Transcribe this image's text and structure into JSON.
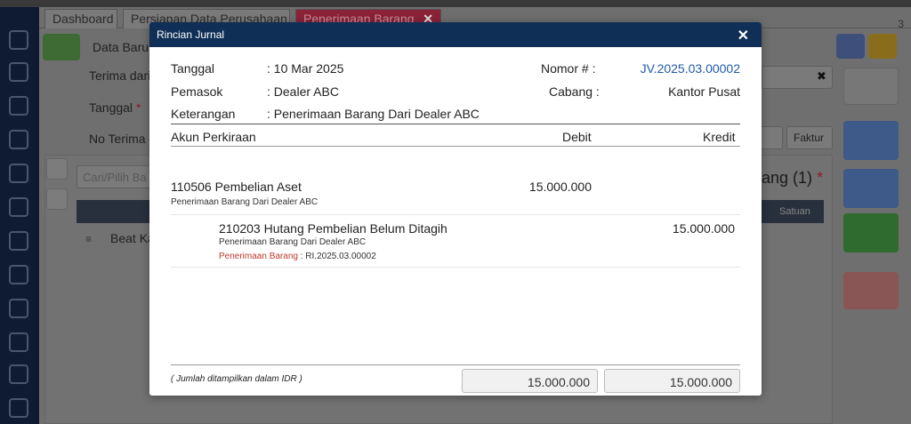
{
  "tabs": [
    {
      "label": "Dashboard"
    },
    {
      "label": "Persiapan Data Perusahaan"
    },
    {
      "label": "Penerimaan Barang"
    }
  ],
  "tab_count": "3",
  "background": {
    "data_baru_label": "Data Baru",
    "terima_dari_label": "Terima dari",
    "tanggal_label": "Tanggal",
    "required_mark": "*",
    "no_terima_label": "No Terima #",
    "search_placeholder": "Cari/Pilih Ba",
    "barang_count": "ang (1)",
    "row_item": "Beat Ka",
    "satuan_header": "Satuan",
    "faktur_button": "Faktur"
  },
  "modal": {
    "title": "Rincian Jurnal",
    "tanggal_label": "Tanggal",
    "tanggal_value": ": 10 Mar 2025",
    "pemasok_label": "Pemasok",
    "pemasok_value": ": Dealer ABC",
    "keterangan_label": "Keterangan",
    "keterangan_value": ": Penerimaan Barang Dari Dealer ABC",
    "nomor_label": "Nomor # :",
    "nomor_value": "JV.2025.03.00002",
    "cabang_label": "Cabang :",
    "cabang_value": "Kantor Pusat",
    "columns": {
      "akun": "Akun Perkiraan",
      "debit": "Debit",
      "kredit": "Kredit"
    },
    "entries": [
      {
        "account": "110506 Pembelian Aset",
        "description": "Penerimaan Barang Dari Dealer ABC",
        "debit": "15.000.000",
        "kredit": ""
      },
      {
        "account": "210203 Hutang Pembelian Belum Ditagih",
        "description": "Penerimaan Barang Dari Dealer ABC",
        "ref_label": "Penerimaan Barang",
        "ref_value": " : RI.2025.03.00002",
        "debit": "",
        "kredit": "15.000.000"
      }
    ],
    "footer_note": "( Jumlah ditampilkan dalam IDR )",
    "total_debit": "15.000.000",
    "total_kredit": "15.000.000"
  },
  "colors": {
    "header": "#0f2f57",
    "link": "#1e5aa8",
    "ref_label": "#c0392b"
  }
}
